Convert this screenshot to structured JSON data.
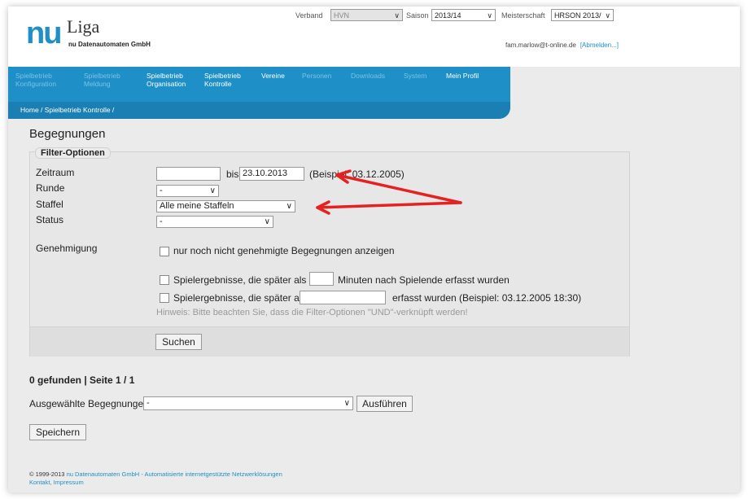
{
  "header": {
    "logo_nu": "nu",
    "logo_liga": "Liga",
    "logo_sub": "nu Datenautomaten GmbH",
    "verband_label": "Verband",
    "verband_value": "HVN",
    "saison_label": "Saison",
    "saison_value": "2013/14",
    "meisterschaft_label": "Meisterschaft",
    "meisterschaft_value": "HRSON 2013/",
    "user_email": "fam.marlow@t-online.de",
    "logout_link": "[Abmelden...]"
  },
  "nav": {
    "items": [
      {
        "label_l1": "Spielbetrieb",
        "label_l2": "Konfiguration"
      },
      {
        "label_l1": "Spielbetrieb",
        "label_l2": "Meldung"
      },
      {
        "label_l1": "Spielbetrieb",
        "label_l2": "Organisation"
      },
      {
        "label_l1": "Spielbetrieb",
        "label_l2": "Kontrolle"
      },
      {
        "label_l1": "Vereine",
        "label_l2": ""
      },
      {
        "label_l1": "Personen",
        "label_l2": ""
      },
      {
        "label_l1": "Downloads",
        "label_l2": ""
      },
      {
        "label_l1": "System",
        "label_l2": ""
      },
      {
        "label_l1": "Mein Profil",
        "label_l2": ""
      }
    ],
    "breadcrumb": "Home / Spielbetrieb Kontrolle /"
  },
  "page": {
    "title": "Begegnungen",
    "filter": {
      "legend": "Filter-Optionen",
      "zeitraum_label": "Zeitraum",
      "zeitraum_from": "",
      "bis_label": "bis",
      "zeitraum_to": "23.10.2013",
      "zeitraum_example": "(Beispiel: 03.12.2005)",
      "runde_label": "Runde",
      "runde_value": "-",
      "staffel_label": "Staffel",
      "staffel_value": "Alle meine Staffeln",
      "status_label": "Status",
      "status_value": "-",
      "genehmigung_label": "Genehmigung",
      "genehmigung_cb": "nur noch nicht genehmigte Begegnungen anzeigen",
      "spieler1_pre": "Spielergebnisse, die später als",
      "spieler1_post": "Minuten nach Spielende erfasst wurden",
      "spieler2_pre": "Spielergebnisse, die später als",
      "spieler2_post": "erfasst wurden (Beispiel: 03.12.2005 18:30)",
      "hint": "Hinweis: Bitte beachten Sie, dass die Filter-Optionen \"UND\"-verknüpft werden!",
      "search_button": "Suchen"
    },
    "result_text": "0 gefunden | Seite 1 / 1",
    "selected_label": "Ausgewählte Begegnungen",
    "selected_value": "-",
    "execute_button": "Ausführen",
    "save_button": "Speichern"
  },
  "footer": {
    "line1_prefix": "© 1999-2013",
    "line1_link": "nu Datenautomaten GmbH",
    "line1_suffix": "- Automatisierte internetgestützte Netzwerklösungen",
    "line2": "Kontakt, Impressum"
  }
}
